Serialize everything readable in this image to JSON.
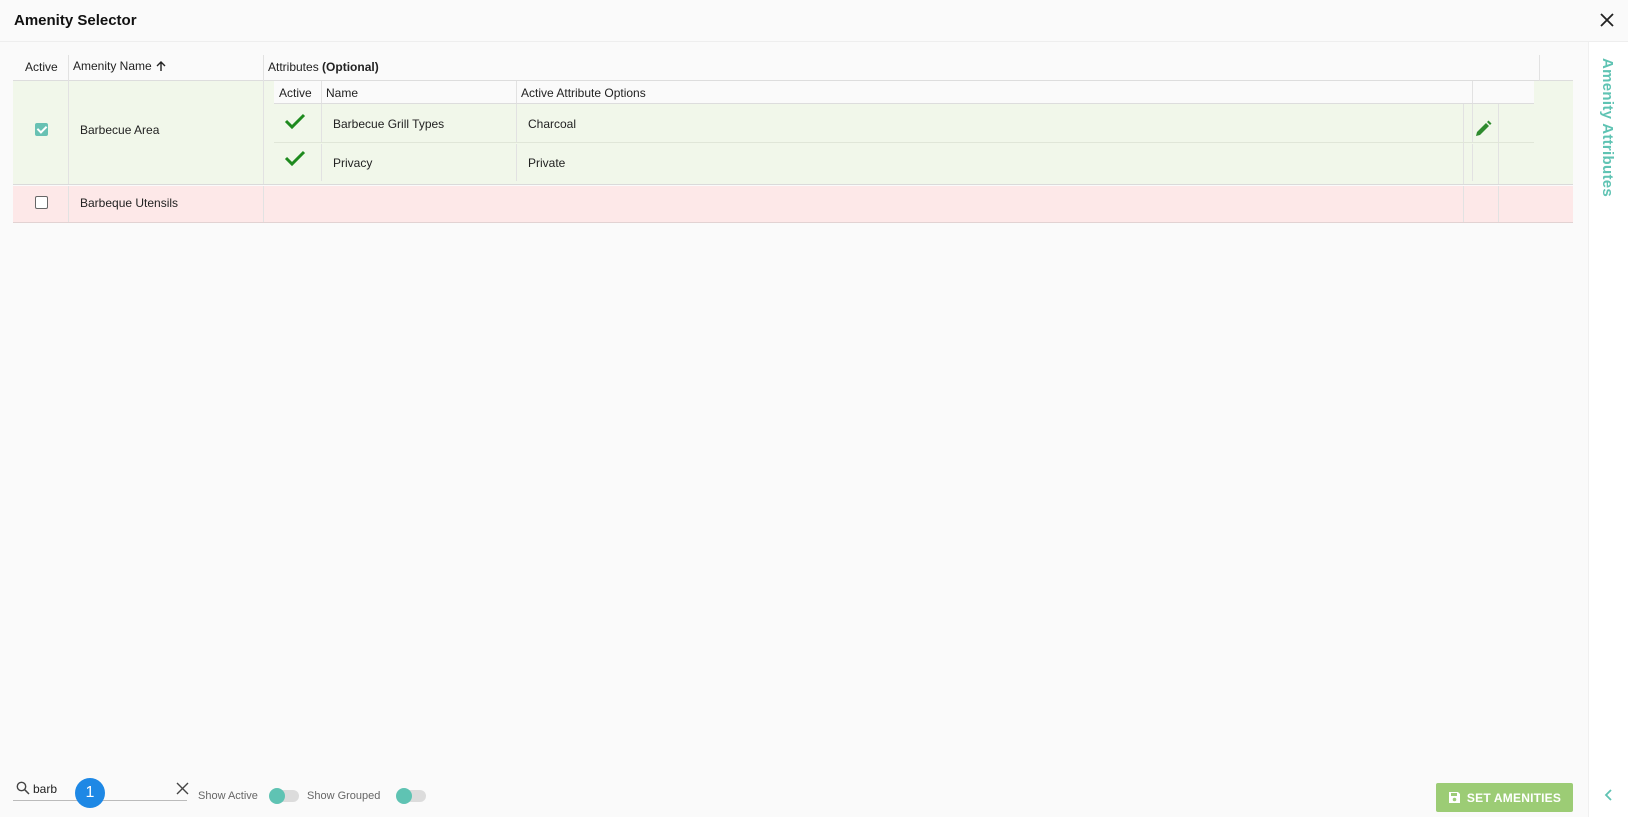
{
  "window": {
    "title": "Amenity Selector"
  },
  "side_panel": {
    "title": "Amenity Attributes"
  },
  "grid": {
    "headers": {
      "active": "Active",
      "amenity_name": "Amenity Name",
      "attributes": "Attributes",
      "attributes_suffix": "(Optional)"
    },
    "sub_headers": {
      "active": "Active",
      "name": "Name",
      "options": "Active Attribute Options"
    },
    "rows": [
      {
        "name": "Barbecue Area",
        "active": true,
        "attributes": [
          {
            "name": "Barbecue Grill Types",
            "option": "Charcoal",
            "active": true
          },
          {
            "name": "Privacy",
            "option": "Private",
            "active": true
          }
        ]
      },
      {
        "name": "Barbeque Utensils",
        "active": false,
        "attributes": []
      }
    ]
  },
  "footer": {
    "search_value": "barb",
    "badge": "1",
    "show_active_label": "Show Active",
    "show_grouped_label": "Show Grouped",
    "set_button_label": "SET AMENITIES"
  },
  "colors": {
    "accent": "#5fc3b3",
    "active_row": "#f1f7ea",
    "inactive_row": "#fde8e8",
    "check_green": "#1e8a1e",
    "button_green": "#9ccc75",
    "badge_blue": "#1e88e5"
  }
}
